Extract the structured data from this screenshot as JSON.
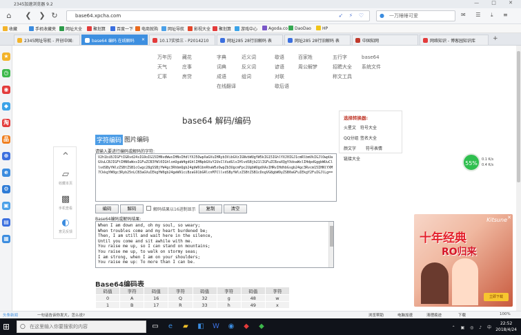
{
  "window": {
    "title": "2345加速浏览器 9.2"
  },
  "nav": {
    "url": "base64.xpcha.com",
    "search_placeholder": "一万睡睡可爱",
    "back_icon": "arrow-left-icon",
    "forward_icon": "arrow-right-icon",
    "refresh_icon": "refresh-icon",
    "home_icon": "home-icon"
  },
  "bookmarks": [
    {
      "label": "收藏",
      "color": "#f3b32a"
    },
    {
      "label": "手机收藏夹",
      "color": "#3b8cdf"
    },
    {
      "label": "网址大全",
      "color": "#2d9b4a"
    },
    {
      "label": "聚划算",
      "color": "#e33b3b"
    },
    {
      "label": "百度一下",
      "color": "#3b6fdf"
    },
    {
      "label": "电商就购",
      "color": "#e96a1c"
    },
    {
      "label": "网址导航",
      "color": "#4aa0e8"
    },
    {
      "label": "影视大全",
      "color": "#e4462b"
    },
    {
      "label": "聚划算",
      "color": "#e33b3b"
    },
    {
      "label": "游戏中心",
      "color": "#3ba3e8"
    },
    {
      "label": "Agoda.co",
      "color": "#7a57c8"
    },
    {
      "label": "DaoDao",
      "color": "#35a852"
    },
    {
      "label": "HP",
      "color": "#f0c419"
    }
  ],
  "tabs": [
    {
      "label": "2345网址导航 - 开创中国:",
      "color": "#f3b32a"
    },
    {
      "label": "base64 编码 在线解码",
      "color": "#3d8fe0"
    },
    {
      "label": "10.17实验三 - P2014210",
      "color": "#e33b3b"
    },
    {
      "label": "网址285 28行旧解码 表",
      "color": "#3b6fdf"
    },
    {
      "label": "网址285 28行旧解码 表",
      "color": "#3b6fdf"
    },
    {
      "label": "中国知网",
      "color": "#c0392b"
    },
    {
      "label": "网络知识 - 博客园知识库",
      "color": "#e33b3b"
    }
  ],
  "site_menu": {
    "col1": [
      "万年历",
      "天气",
      "汇率"
    ],
    "col2": [
      "藏花",
      "庄事",
      "房贷"
    ],
    "col3": [
      "字典",
      "词典",
      "成语",
      "在线翻译"
    ],
    "col4": [
      "近义词",
      "反义词",
      "组词"
    ],
    "col5": [
      "歇语",
      "谚语",
      "对联",
      "歇后语"
    ],
    "col6": [
      "百家姓",
      "周公解梦"
    ],
    "col7": [
      "五行字",
      "招聘大全",
      "称文工具"
    ],
    "col8": [
      "base64",
      "系统文件"
    ]
  },
  "page": {
    "title": "base64 解码/编码",
    "tab_text": "字符编码",
    "tab_image": "图片编码",
    "input_prompt": "请输入要进行编码或解码的字符:",
    "input_value": "V2h1biBJIGFtIGRvd24sIG9oIG15IHNvdWwsIHNvIHdlYXJ5OwpXaGVuIHRyb3VibGVzIGNvbWUgYW5kIG15IGhlYXJ0IGJ1cmRlbmVkIGJlOwpUaGVuLCBJIGFtIHN0aWxsIGFuZCB3YWl0IGhlcmUgaW4gdGhlIHNpbGVuY2UsClVudGlsIHlvdSBjb21lIGFuZCBzaXQgYXdoaWxlIHdpdGggbWUuCllvdSByYWlzZSBtZSB1cCwgc28gSSBjYW4gc3RhbmQgb24gbW91bnRhaW5zOwpZb3UgcmFpc2UgbWUgdXAsIHRvIHdhbGsgb24gc3Rvcm15IHNlYXM7CkkgYW0gc3Ryb25nLCB3aGVuIEkgYW0gb24geW91ciBzaG91bGRlcnM7CllvdSByYWlzZSBtZSB1cDogVG8gbW9yZSB0aGFuIEkgY2FuIGJlLg==",
    "btn_encode": "编码",
    "btn_decode": "解码",
    "checkbox_label": "解码结果以16进制显示",
    "btn_copy": "复制",
    "btn_clear": "清空",
    "output_prompt": "Base64编码或解码结果:",
    "output_lines": [
      "When I am down and, oh my soul, so weary;",
      "When troubles come and my heart burdened be;",
      "Then, I am still and wait here in the silence,",
      "Until you come and sit awhile with me.",
      "You raise me up, so I can stand on mountains;",
      "You raise me up, to walk on stormy seas;",
      "I am strong, when I am on your shoulders;",
      "You raise me up: To more than I can be."
    ],
    "table_title": "Base64编码表",
    "table_headers": [
      "码值",
      "字符",
      "码值",
      "字符",
      "码值",
      "字符",
      "码值",
      "字符"
    ],
    "table_rows": [
      [
        "0",
        "A",
        "16",
        "Q",
        "32",
        "g",
        "48",
        "w"
      ],
      [
        "1",
        "B",
        "17",
        "R",
        "33",
        "h",
        "49",
        "x"
      ]
    ]
  },
  "related": {
    "heading": "选择转换器:",
    "items": [
      "火星文",
      "符号大全",
      "QQ分组",
      "签名大全",
      "颜文字",
      "符号表情",
      "链接大全"
    ]
  },
  "floatbar": {
    "up_icon": "chevron-up-icon",
    "fav_label": "收藏本页",
    "qr_label": "手机查看",
    "feedback_label": "意见反馈"
  },
  "netmon": {
    "percent": "55%",
    "up": "0.1 K/s",
    "down": "0.4 K/s"
  },
  "ad": {
    "brand": "Kitsune",
    "title": "十年经典",
    "subtitle": "RO归来",
    "button": "立即下载"
  },
  "statusbar": {
    "left1": "头条新闻",
    "left2": "一句话告诉你发大，怎么说?",
    "r1": "浏览帮助",
    "r2": "电脑加速",
    "r3": "清理痕迹",
    "r4": "下载",
    "zoom": "100%"
  },
  "taskbar": {
    "search_placeholder": "在这里输入你要搜索的内容",
    "time": "22:52",
    "date": "2018/4/24"
  }
}
